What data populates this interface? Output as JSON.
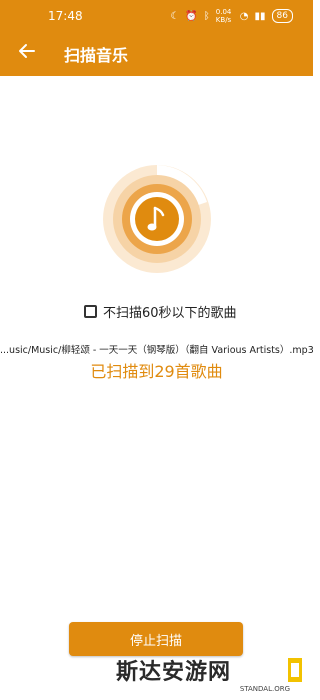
{
  "status_bar": {
    "time": "17:48",
    "speed": "0.04 KB/s",
    "battery": "86"
  },
  "appbar": {
    "title": "扫描音乐"
  },
  "scan": {
    "checkbox_label": "不扫描60秒以下的歌曲",
    "checkbox_checked": false,
    "current_file": "...usic/Music/柳轻颂 - 一天一天（钢琴版）（翻自 Various Artists）.mp3",
    "count_text": "已扫描到29首歌曲",
    "stop_label": "停止扫描"
  },
  "watermark": {
    "text": "斯达安游网",
    "sub": "STANDAL.ORG"
  },
  "colors": {
    "accent": "#E08B0F",
    "text": "#222222",
    "background": "#FFFFFF"
  }
}
